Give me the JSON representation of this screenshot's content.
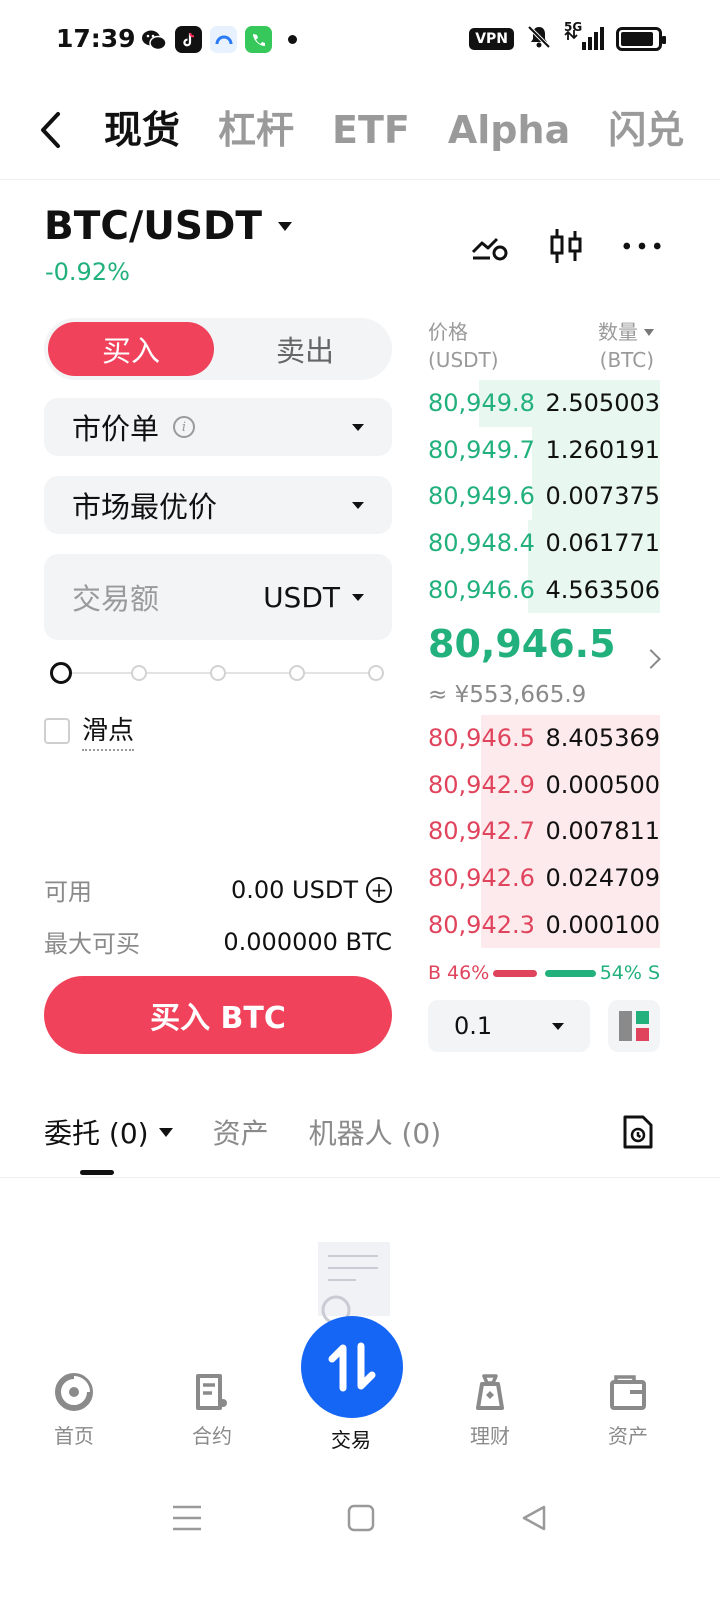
{
  "status": {
    "time": "17:39",
    "vpn": "VPN",
    "network": "5G",
    "battery_level": 0.9
  },
  "topnav": {
    "tabs": [
      {
        "label": "现货",
        "active": true
      },
      {
        "label": "杠杆",
        "active": false
      },
      {
        "label": "ETF",
        "active": false
      },
      {
        "label": "Alpha",
        "active": false
      },
      {
        "label": "闪兑",
        "active": false
      }
    ]
  },
  "pair": {
    "symbol": "BTC/USDT",
    "change": "-0.92%"
  },
  "order_form": {
    "side_buy": "买入",
    "side_sell": "卖出",
    "order_type": "市价单",
    "price_mode": "市场最优价",
    "amount_placeholder": "交易额",
    "amount_unit": "USDT",
    "slider_value": 0,
    "slippage_label": "滑点",
    "available_label": "可用",
    "available_value": "0.00 USDT",
    "max_buy_label": "最大可买",
    "max_buy_value": "0.000000 BTC",
    "submit_label": "买入 BTC"
  },
  "orderbook": {
    "price_header": "价格",
    "price_unit": "(USDT)",
    "qty_header": "数量",
    "qty_unit": "(BTC)",
    "asks": [
      {
        "price": "80,949.8",
        "qty": "2.505003",
        "depth": 0.78
      },
      {
        "price": "80,949.7",
        "qty": "1.260191",
        "depth": 0.55
      },
      {
        "price": "80,949.6",
        "qty": "0.007375",
        "depth": 0.55
      },
      {
        "price": "80,948.4",
        "qty": "0.061771",
        "depth": 0.57
      },
      {
        "price": "80,946.6",
        "qty": "4.563506",
        "depth": 0.57
      }
    ],
    "last_price": "80,946.5",
    "fiat_price": "≈ ¥553,665.9",
    "bids": [
      {
        "price": "80,946.5",
        "qty": "8.405369",
        "depth": 0.77
      },
      {
        "price": "80,942.9",
        "qty": "0.000500",
        "depth": 0.77
      },
      {
        "price": "80,942.7",
        "qty": "0.007811",
        "depth": 0.77
      },
      {
        "price": "80,942.6",
        "qty": "0.024709",
        "depth": 0.77
      },
      {
        "price": "80,942.3",
        "qty": "0.000100",
        "depth": 0.77
      }
    ],
    "ratio_buy_label": "B",
    "ratio_buy": "46%",
    "ratio_buy_value": 46,
    "ratio_sell_label": "S",
    "ratio_sell": "54%",
    "ratio_sell_value": 54,
    "depth_step": "0.1"
  },
  "lower_tabs": [
    {
      "label": "委托 (0)",
      "active": true
    },
    {
      "label": "资产",
      "active": false
    },
    {
      "label": "机器人 (0)",
      "active": false
    }
  ],
  "bottomnav": {
    "items": [
      {
        "label": "首页",
        "icon": "home-icon"
      },
      {
        "label": "合约",
        "icon": "contract-icon"
      },
      {
        "label": "交易",
        "icon": "trade-icon"
      },
      {
        "label": "理财",
        "icon": "finance-icon"
      },
      {
        "label": "资产",
        "icon": "wallet-icon"
      }
    ]
  },
  "colors": {
    "up": "#22b07d",
    "down": "#e0445c",
    "buy_button": "#f0425a",
    "accent_blue": "#1666f5"
  }
}
